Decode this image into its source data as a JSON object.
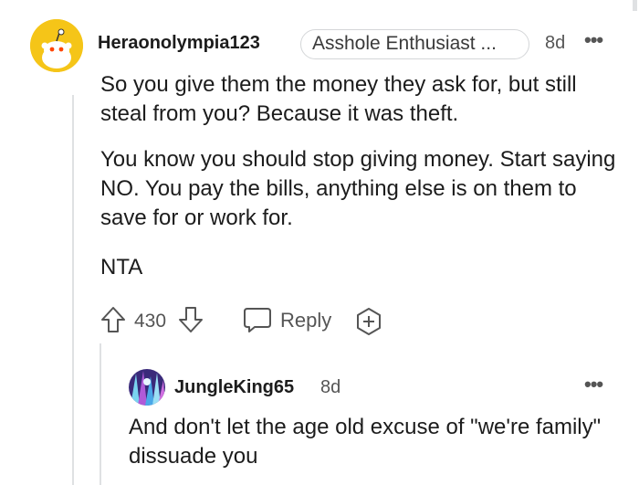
{
  "comment": {
    "username": "Heraonolympia123",
    "flair": "Asshole Enthusiast ...",
    "time": "8d",
    "more_icon": "more-dots-icon",
    "paragraphs": [
      "So you give them the money they ask for, but still steal from you? Because it was theft.",
      "You know you should stop giving money. Start saying NO. You pay the bills, anything else is on them to save for or work for.",
      "NTA"
    ],
    "votes": "430",
    "reply_label": "Reply",
    "icons": [
      "upvote-icon",
      "downvote-icon",
      "reply-icon",
      "award-icon"
    ],
    "avatar_color": "#f5c518"
  },
  "reply": {
    "username": "JungleKing65",
    "time": "8d",
    "body": "And don't let the age old excuse of \"we're family\" dissuade you"
  }
}
